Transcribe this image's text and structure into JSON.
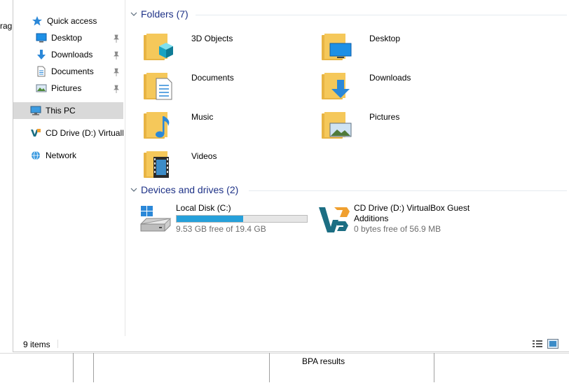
{
  "background": {
    "left_text": "rag",
    "bottom_label": "BPA results"
  },
  "nav": {
    "items": [
      {
        "label": "Quick access",
        "icon": "star-icon"
      },
      {
        "label": "Desktop",
        "icon": "desktop-icon",
        "pinned": true
      },
      {
        "label": "Downloads",
        "icon": "download-arrow-icon",
        "pinned": true
      },
      {
        "label": "Documents",
        "icon": "document-icon",
        "pinned": true
      },
      {
        "label": "Pictures",
        "icon": "pictures-icon",
        "pinned": true
      },
      {
        "label": "This PC",
        "icon": "computer-icon",
        "selected": true
      },
      {
        "label": "CD Drive (D:) VirtualB",
        "icon": "virtualbox-icon"
      },
      {
        "label": "Network",
        "icon": "network-icon"
      }
    ]
  },
  "content": {
    "folders_header": "Folders (7)",
    "folders": [
      {
        "name": "3D Objects",
        "icon": "3d-objects-folder-icon"
      },
      {
        "name": "Desktop",
        "icon": "desktop-folder-icon"
      },
      {
        "name": "Documents",
        "icon": "documents-folder-icon"
      },
      {
        "name": "Downloads",
        "icon": "downloads-folder-icon"
      },
      {
        "name": "Music",
        "icon": "music-folder-icon"
      },
      {
        "name": "Pictures",
        "icon": "pictures-folder-icon"
      },
      {
        "name": "Videos",
        "icon": "videos-folder-icon"
      }
    ],
    "drives_header": "Devices and drives (2)",
    "drives": [
      {
        "name": "Local Disk (C:)",
        "free_text": "9.53 GB free of 19.4 GB",
        "used_fraction": 0.509,
        "icon": "hard-disk-icon"
      },
      {
        "name_line1": "CD Drive (D:) VirtualBox Guest",
        "name_line2": "Additions",
        "free_text": "0 bytes free of 56.9 MB",
        "icon": "virtualbox-icon"
      }
    ]
  },
  "status": {
    "item_count": "9 items"
  },
  "colors": {
    "group_header": "#1e3287",
    "selection": "#d9d9d9",
    "drive_fill": "#26a0da",
    "folder_yellow": "#f5c85a"
  }
}
